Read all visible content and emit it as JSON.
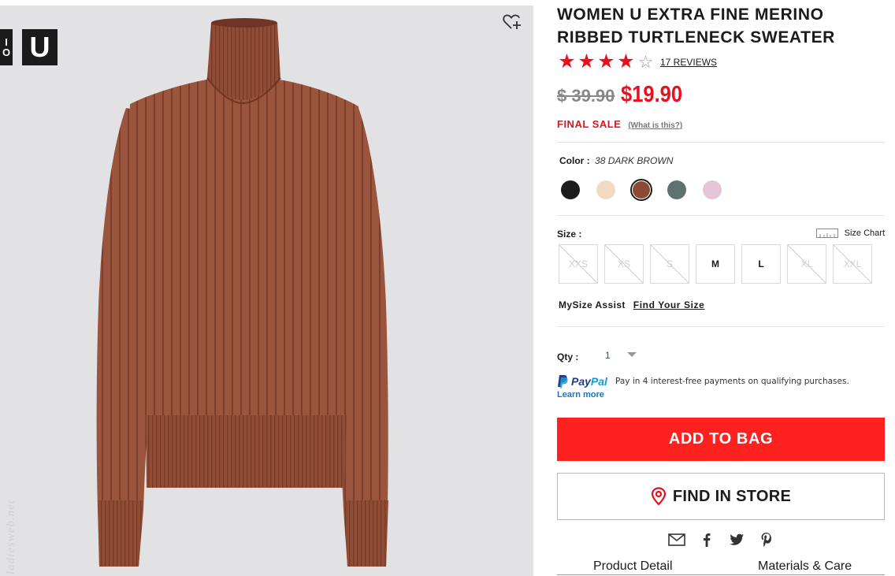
{
  "product": {
    "title_line1": "WOMEN U EXTRA FINE MERINO",
    "title_line2": "RIBBED TURTLENECK SWEATER",
    "rating_stars": 4,
    "rating_max": 5,
    "reviews_label": "17 REVIEWS",
    "old_price": "$ 39.90",
    "new_price": "$19.90",
    "final_sale_label": "FINAL SALE",
    "what_is_this": "(What is this?)"
  },
  "logo": {
    "tile_a_top": "I",
    "tile_a_bottom": "O",
    "tile_b": "U"
  },
  "watermark": "ladiesweb.net",
  "color": {
    "label": "Color :",
    "selected_name": "38 DARK BROWN",
    "swatches": [
      {
        "name": "black",
        "hex": "#1c1c1c"
      },
      {
        "name": "cream",
        "hex": "#f2d9c4"
      },
      {
        "name": "dark-brown",
        "hex": "#8c4a34",
        "selected": true
      },
      {
        "name": "green",
        "hex": "#5e7370"
      },
      {
        "name": "pink",
        "hex": "#e6c5d9"
      }
    ]
  },
  "size": {
    "label": "Size :",
    "chart_label": "Size Chart",
    "options": [
      {
        "label": "XXS",
        "available": false
      },
      {
        "label": "XS",
        "available": false
      },
      {
        "label": "S",
        "available": false
      },
      {
        "label": "M",
        "available": true
      },
      {
        "label": "L",
        "available": true
      },
      {
        "label": "XL",
        "available": false
      },
      {
        "label": "XXL",
        "available": false
      }
    ]
  },
  "mysize": {
    "label": "MySize Assist",
    "link": "Find Your Size"
  },
  "qty": {
    "label": "Qty :",
    "value": "1"
  },
  "paypal": {
    "brand_part1": "Pay",
    "brand_part2": "Pal",
    "message": "Pay in 4 interest-free payments on qualifying purchases.",
    "learn_more": "Learn more"
  },
  "actions": {
    "add_to_bag": "ADD TO BAG",
    "find_in_store": "FIND IN STORE"
  },
  "tabs": {
    "product_detail": "Product Detail",
    "materials_care": "Materials & Care"
  },
  "colors": {
    "accent_red": "#ff2020",
    "sweater_brown": "#98533b"
  }
}
